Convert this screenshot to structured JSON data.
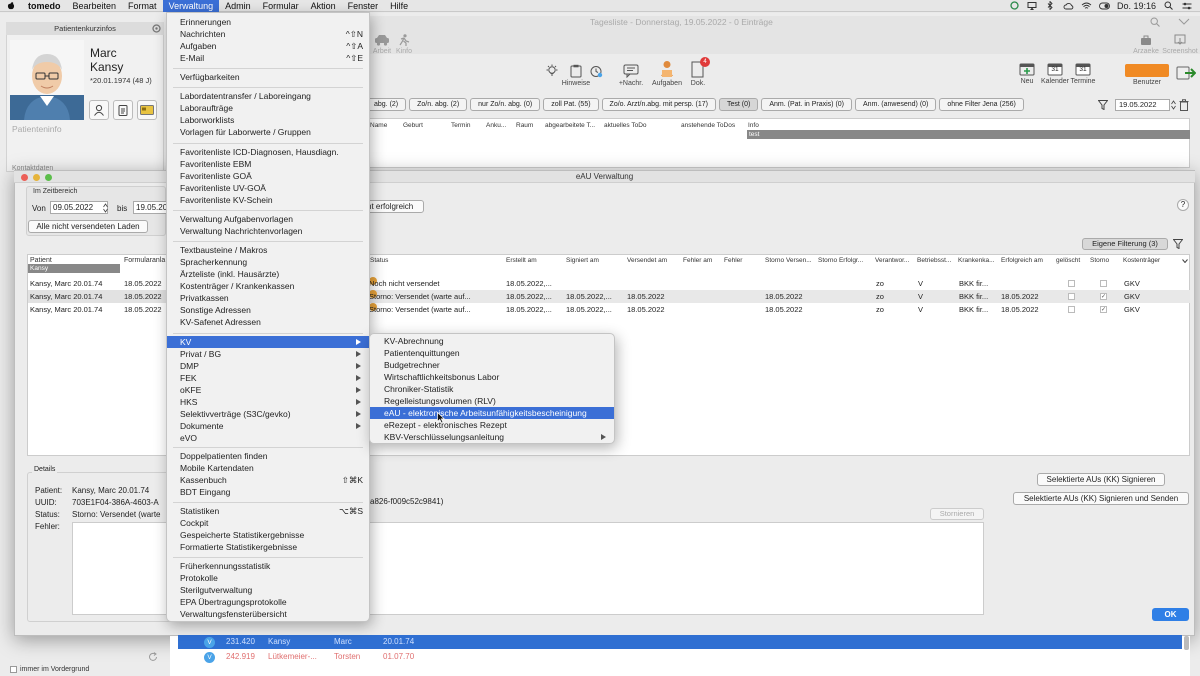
{
  "menubar": {
    "app_name": "tomedo",
    "items": [
      "Bearbeiten",
      "Format",
      "Verwaltung",
      "Admin",
      "Formular",
      "Aktion",
      "Fenster",
      "Hilfe"
    ],
    "active_item": "Verwaltung",
    "clock": "Do. 19:16"
  },
  "window": {
    "title": "Tagesliste - Donnerstag, 19.05.2022 - 0 Einträge"
  },
  "toolbar": {
    "top_faded": [
      "Arbeit",
      "Kinfo"
    ],
    "top_right": [
      "Arzaeke",
      "Screenshot"
    ],
    "buttons": [
      "Hinweise",
      "+Nachr.",
      "Aufgaben",
      "Dok."
    ],
    "right_buttons": [
      "Neu",
      "Kalender",
      "Termine"
    ],
    "benutzer_label": "Benutzer",
    "dok_badge": "4",
    "kalender_day": "31",
    "termine_day": "31"
  },
  "patient": {
    "panel_title": "Patientenkurzinfos",
    "first_name": "Marc",
    "last_name": "Kansy",
    "dob": "*20.01.1974 (48 J)",
    "info_label": "Patienteninfo",
    "kontakt_label": "Kontaktdaten"
  },
  "tabs": {
    "items": [
      "abg. (2)",
      "Zo/n. abg. (2)",
      "nur Zo/n. abg. (0)",
      "zoll Pat. (55)",
      "Zo/o. Arzt/n.abg. mit persp. (17)",
      "Test (0)",
      "Anm. (Pat. in Praxis) (0)",
      "Anm. (anwesend) (0)",
      "ohne Filter Jena (256)"
    ],
    "selected": "Test (0)",
    "date": "19.05.2022"
  },
  "grid1": {
    "headers": [
      "Name",
      "Geburt",
      "Termin",
      "Anku...",
      "Raum",
      "abgearbeitete T...",
      "aktuelles ToDo",
      "anstehende ToDos",
      "Info"
    ],
    "test_row": "test"
  },
  "dialog": {
    "title": "eAU Verwaltung",
    "zeitbereich_label": "Im Zeitbereich",
    "von_label": "Von",
    "von_value": "09.05.2022",
    "bis_label": "bis",
    "bis_value": "19.05.2022",
    "alle_button": "Alle nicht versendeten Laden",
    "erfolg_button": "nt erfolgreich",
    "help": "?",
    "eigene_button": "Eigene Filterung (3)",
    "left_headers": [
      "Patient",
      "Formularanla"
    ],
    "left_filter": "Kansy",
    "left_rows": [
      {
        "patient": "Kansy, Marc 20.01.74",
        "date": "18.05.2022"
      },
      {
        "patient": "Kansy, Marc 20.01.74",
        "date": "18.05.2022"
      },
      {
        "patient": "Kansy, Marc 20.01.74",
        "date": "18.05.2022"
      }
    ],
    "headers": [
      "Status",
      "Erstellt am",
      "Signiert am",
      "Versendet am",
      "Fehler am",
      "Fehler",
      "Storno Versen...",
      "Storno Erfolgr...",
      "Verantwor...",
      "Betriebsst...",
      "Krankenka...",
      "Erfolgreich am",
      "gelöscht",
      "Storno",
      "Kostenträger"
    ],
    "rows": [
      {
        "status": "Noch nicht versendet",
        "erstellt": "18.05.2022,...",
        "signiert": "",
        "versendet": "",
        "storno_versendet": "",
        "verantwortlich": "zo",
        "betriebsstaette": "V",
        "krankenkasse": "BKK fir...",
        "erfolgreich": "",
        "storno_check": "",
        "kostentraeger": "GKV"
      },
      {
        "status": "Storno: Versendet (warte auf...",
        "erstellt": "18.05.2022,...",
        "signiert": "18.05.2022,...",
        "versendet": "18.05.2022",
        "storno_versendet": "18.05.2022",
        "verantwortlich": "zo",
        "betriebsstaette": "V",
        "krankenkasse": "BKK fir...",
        "erfolgreich": "18.05.2022",
        "storno_check": "✓",
        "kostentraeger": "GKV"
      },
      {
        "status": "Storno: Versendet (warte auf...",
        "erstellt": "18.05.2022,...",
        "signiert": "18.05.2022,...",
        "versendet": "18.05.2022",
        "storno_versendet": "18.05.2022",
        "verantwortlich": "zo",
        "betriebsstaette": "V",
        "krankenkasse": "BKK fir...",
        "erfolgreich": "18.05.2022",
        "storno_check": "✓",
        "kostentraeger": "GKV"
      }
    ],
    "details": {
      "label": "Details",
      "patient_label": "Patient:",
      "patient_value": "Kansy, Marc 20.01.74",
      "uuid_label": "UUID:",
      "uuid_value": "703E1F04-386A-4603-A",
      "uuid_rest": "a826-f009c52c9841)",
      "status_label": "Status:",
      "status_value": "Storno: Versendet (warte",
      "fehler_label": "Fehler:"
    },
    "stornieren_button": "Stornieren",
    "sign_button": "Selektierte AUs (KK) Signieren",
    "sign_send_button": "Selektierte AUs (KK) Signieren und Senden",
    "ok_button": "OK"
  },
  "bottom_list": {
    "rows": [
      {
        "badge": "V",
        "id": "231.420",
        "last": "Kansy",
        "first": "Marc",
        "dob": "20.01.74"
      },
      {
        "badge": "V",
        "id": "242.919",
        "last": "Lütkemeier-...",
        "first": "Torsten",
        "dob": "01.07.70"
      }
    ],
    "always_front": "immer im Vordergrund"
  },
  "verwaltung_menu": {
    "groups": [
      [
        {
          "label": "Erinnerungen",
          "shortcut": ""
        },
        {
          "label": "Nachrichten",
          "shortcut": "^⇧N"
        },
        {
          "label": "Aufgaben",
          "shortcut": "^⇧A"
        },
        {
          "label": "E-Mail",
          "shortcut": "^⇧E"
        }
      ],
      [
        {
          "label": "Verfügbarkeiten",
          "shortcut": ""
        }
      ],
      [
        {
          "label": "Labordatentransfer / Laboreingang",
          "shortcut": ""
        },
        {
          "label": "Laboraufträge",
          "shortcut": ""
        },
        {
          "label": "Laborworklists",
          "shortcut": ""
        },
        {
          "label": "Vorlagen für Laborwerte / Gruppen",
          "shortcut": ""
        }
      ],
      [
        {
          "label": "Favoritenliste ICD-Diagnosen, Hausdiagn.",
          "shortcut": ""
        },
        {
          "label": "Favoritenliste EBM",
          "shortcut": ""
        },
        {
          "label": "Favoritenliste GOÄ",
          "shortcut": ""
        },
        {
          "label": "Favoritenliste UV-GOÄ",
          "shortcut": ""
        },
        {
          "label": "Favoritenliste KV-Schein",
          "shortcut": ""
        }
      ],
      [
        {
          "label": "Verwaltung Aufgabenvorlagen",
          "shortcut": ""
        },
        {
          "label": "Verwaltung Nachrichtenvorlagen",
          "shortcut": ""
        }
      ],
      [
        {
          "label": "Textbausteine / Makros",
          "shortcut": ""
        },
        {
          "label": "Spracherkennung",
          "shortcut": ""
        },
        {
          "label": "Ärzteliste (inkl. Hausärzte)",
          "shortcut": ""
        },
        {
          "label": "Kostenträger / Krankenkassen",
          "shortcut": ""
        },
        {
          "label": "Privatkassen",
          "shortcut": ""
        },
        {
          "label": "Sonstige Adressen",
          "shortcut": ""
        },
        {
          "label": "KV-Safenet Adressen",
          "shortcut": ""
        }
      ],
      [
        {
          "label": "KV",
          "shortcut": "",
          "submenu": true,
          "highlighted": true
        },
        {
          "label": "Privat / BG",
          "shortcut": "",
          "submenu": true
        },
        {
          "label": "DMP",
          "shortcut": "",
          "submenu": true
        },
        {
          "label": "FEK",
          "shortcut": "",
          "submenu": true
        },
        {
          "label": "oKFE",
          "shortcut": "",
          "submenu": true
        },
        {
          "label": "HKS",
          "shortcut": "",
          "submenu": true
        },
        {
          "label": "Selektivverträge (S3C/gevko)",
          "shortcut": "",
          "submenu": true
        },
        {
          "label": "Dokumente",
          "shortcut": "",
          "submenu": true
        },
        {
          "label": "eVO",
          "shortcut": ""
        }
      ],
      [
        {
          "label": "Doppelpatienten finden",
          "shortcut": ""
        },
        {
          "label": "Mobile Kartendaten",
          "shortcut": ""
        },
        {
          "label": "Kassenbuch",
          "shortcut": "⇧⌘K"
        },
        {
          "label": "BDT Eingang",
          "shortcut": ""
        }
      ],
      [
        {
          "label": "Statistiken",
          "shortcut": "⌥⌘S"
        },
        {
          "label": "Cockpit",
          "shortcut": ""
        },
        {
          "label": "Gespeicherte Statistikergebnisse",
          "shortcut": ""
        },
        {
          "label": "Formatierte Statistikergebnisse",
          "shortcut": ""
        }
      ],
      [
        {
          "label": "Früherkennungsstatistik",
          "shortcut": ""
        },
        {
          "label": "Protokolle",
          "shortcut": ""
        },
        {
          "label": "Sterilgutverwaltung",
          "shortcut": ""
        },
        {
          "label": "EPA Übertragungsprotokolle",
          "shortcut": ""
        },
        {
          "label": "Verwaltungsfensterübersicht",
          "shortcut": ""
        }
      ]
    ]
  },
  "kv_submenu": {
    "items": [
      {
        "label": "KV-Abrechnung"
      },
      {
        "label": "Patientenquittungen"
      },
      {
        "label": "Budgetrechner"
      },
      {
        "label": "Wirtschaftlichkeitsbonus Labor"
      },
      {
        "label": "Chroniker-Statistik"
      },
      {
        "label": "Regelleistungsvolumen (RLV)"
      },
      {
        "label": "eAU - elektronische Arbeitsunfähigkeitsbescheinigung",
        "highlighted": true
      },
      {
        "label": "eRezept - elektronisches Rezept"
      },
      {
        "label": "KBV-Verschlüsselungsanleitung",
        "submenu": true
      }
    ]
  },
  "colors": {
    "menu_highlight": "#3b6fd6",
    "ok_button": "#2f7fe6",
    "selected_row": "#2f6fd2",
    "status_dot": "#e9a43a"
  }
}
